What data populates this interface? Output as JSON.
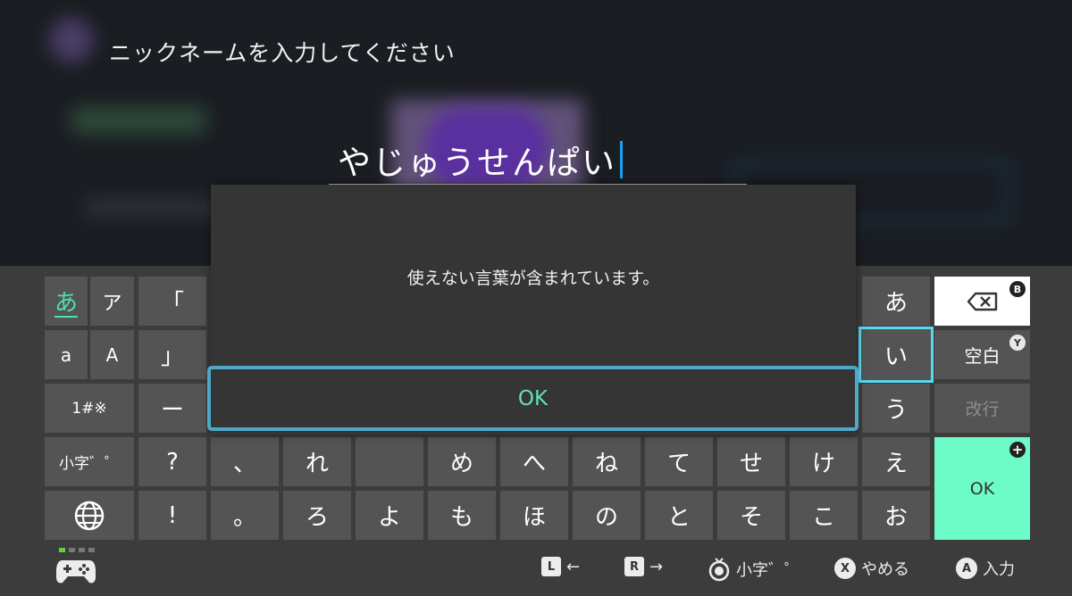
{
  "prompt": "ニックネームを入力してください",
  "input": {
    "value": "やじゅうせんぱい"
  },
  "dialog": {
    "message": "使えない言葉が含まれています。",
    "ok_label": "OK"
  },
  "keyboard": {
    "mode_keys": [
      {
        "id": "hiragana",
        "label": "あ",
        "active": true
      },
      {
        "id": "katakana",
        "label": "ア"
      },
      {
        "id": "lower-latin",
        "label": "a"
      },
      {
        "id": "upper-latin",
        "label": "A"
      },
      {
        "id": "symbols",
        "label": "1#※"
      },
      {
        "id": "small-kana",
        "label": "小字゛゜"
      }
    ],
    "punct_col": [
      "「",
      "」",
      "ー",
      "?",
      "!"
    ],
    "row4": [
      "、",
      "れ",
      "",
      "め",
      "へ",
      "ね",
      "て",
      "せ",
      "け",
      "え"
    ],
    "row5": [
      "。",
      "ろ",
      "よ",
      "も",
      "ほ",
      "の",
      "と",
      "そ",
      "こ",
      "お"
    ],
    "a_col": [
      "あ",
      "い",
      "う"
    ],
    "backspace_badge": "B",
    "space": {
      "label": "空白",
      "badge": "Y"
    },
    "newline": {
      "label": "改行"
    },
    "ok": {
      "label": "OK",
      "badge": "+"
    }
  },
  "hints": {
    "left": {
      "button": "L",
      "arrow": "←"
    },
    "right": {
      "button": "R",
      "arrow": "→"
    },
    "small": {
      "label": "小字゛゜"
    },
    "cancel": {
      "button": "X",
      "label": "やめる"
    },
    "enter": {
      "button": "A",
      "label": "入力"
    }
  },
  "colors": {
    "accent": "#6dfcc7",
    "selection": "#57d9ef",
    "caret": "#1aa0f0"
  }
}
